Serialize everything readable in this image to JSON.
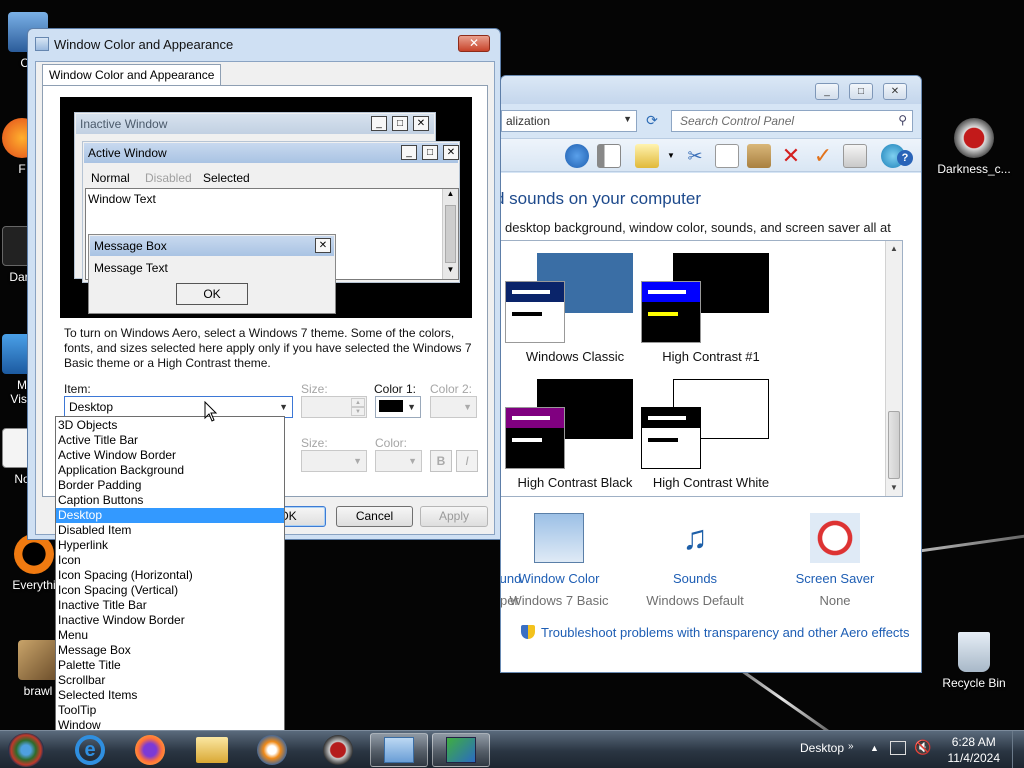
{
  "desktop": {
    "icons_left": [
      {
        "label": "Co"
      },
      {
        "label": "F"
      },
      {
        "label": "Dark"
      },
      {
        "label": "M\nVisu"
      },
      {
        "label": "No"
      },
      {
        "label": "Everythi"
      },
      {
        "label": "brawl"
      }
    ],
    "icons_right": [
      {
        "label": "Darkness_c..."
      },
      {
        "label": "Recycle Bin"
      }
    ]
  },
  "control_panel": {
    "address_text": "alization",
    "search_placeholder": "Search Control Panel",
    "heading": "d sounds on your computer",
    "subtext": "desktop background, window color, sounds, and screen saver all at once.",
    "themes": [
      {
        "name": "Windows Classic"
      },
      {
        "name": "High Contrast #1"
      },
      {
        "name": "High Contrast Black"
      },
      {
        "name": "High Contrast White"
      }
    ],
    "bottom_items": [
      {
        "link": "Desktop Background",
        "value": "darkness_wallpaper"
      },
      {
        "link": "Window Color",
        "value": "Windows 7 Basic"
      },
      {
        "link": "Sounds",
        "value": "Windows Default"
      },
      {
        "link": "Screen Saver",
        "value": "None"
      }
    ],
    "troubleshoot": "Troubleshoot problems with transparency and other Aero effects"
  },
  "dialog": {
    "title": "Window Color and Appearance",
    "tab": "Window Color and Appearance",
    "preview": {
      "inactive_title": "Inactive Window",
      "active_title": "Active Window",
      "menu_normal": "Normal",
      "menu_disabled": "Disabled",
      "menu_selected": "Selected",
      "window_text": "Window Text",
      "message_box_title": "Message Box",
      "message_text": "Message Text",
      "ok": "OK"
    },
    "description": "To turn on Windows Aero, select a Windows 7 theme.  Some of the colors, fonts, and sizes selected here apply only if you have selected the Windows 7 Basic theme or a High Contrast theme.",
    "item_label": "Item:",
    "item_value": "Desktop",
    "size_label": "Size:",
    "color1_label": "Color 1:",
    "color2_label": "Color 2:",
    "font_size_label": "Size:",
    "font_color_label": "Color:",
    "bold": "B",
    "italic": "I",
    "ok_button": "OK",
    "cancel_button": "Cancel",
    "apply_button": "Apply",
    "color1_value": "#000000"
  },
  "item_options": [
    "3D Objects",
    "Active Title Bar",
    "Active Window Border",
    "Application Background",
    "Border Padding",
    "Caption Buttons",
    "Desktop",
    "Disabled Item",
    "Hyperlink",
    "Icon",
    "Icon Spacing (Horizontal)",
    "Icon Spacing (Vertical)",
    "Inactive Title Bar",
    "Inactive Window Border",
    "Menu",
    "Message Box",
    "Palette Title",
    "Scrollbar",
    "Selected Items",
    "ToolTip",
    "Window"
  ],
  "selected_option": "Desktop",
  "taskbar": {
    "desktop_label": "Desktop",
    "time": "6:28 AM",
    "date": "11/4/2024"
  }
}
